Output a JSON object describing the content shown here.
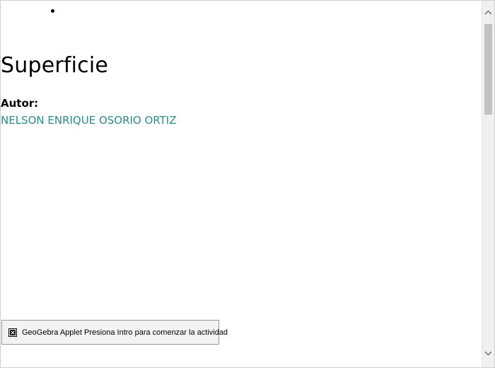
{
  "page": {
    "title": "Superficie",
    "author_label": "Autor:",
    "author_name": "NELSON ENRIQUE OSORIO ORTIZ"
  },
  "applet": {
    "label": "GeoGebra Applet Presiona Intro para comenzar la actividad",
    "icon": "broken-image-icon"
  },
  "scrollbar": {
    "up_icon": "chevron-up-icon",
    "down_icon": "chevron-down-icon",
    "position": 0
  },
  "colors": {
    "author_link": "#2c8c84",
    "applet_bg": "#f3f3f3",
    "scroll_thumb": "#c2c2c2"
  }
}
